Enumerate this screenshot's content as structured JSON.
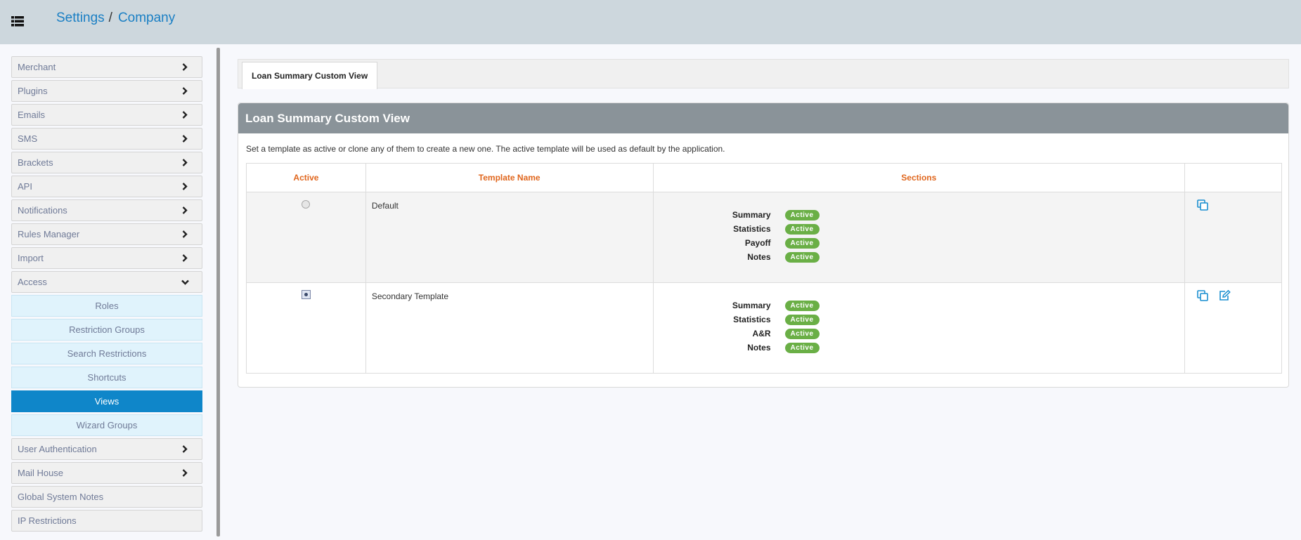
{
  "header": {
    "breadcrumb": [
      "Settings",
      "Company"
    ],
    "breadcrumb_sep": "/"
  },
  "sidebar": {
    "items": [
      {
        "label": "Merchant",
        "chevron": "right"
      },
      {
        "label": "Plugins",
        "chevron": "right"
      },
      {
        "label": "Emails",
        "chevron": "right"
      },
      {
        "label": "SMS",
        "chevron": "right"
      },
      {
        "label": "Brackets",
        "chevron": "right"
      },
      {
        "label": "API",
        "chevron": "right"
      },
      {
        "label": "Notifications",
        "chevron": "right"
      },
      {
        "label": "Rules Manager",
        "chevron": "right"
      },
      {
        "label": "Import",
        "chevron": "right"
      },
      {
        "label": "Access",
        "chevron": "down"
      }
    ],
    "access_subitems": [
      {
        "label": "Roles"
      },
      {
        "label": "Restriction Groups"
      },
      {
        "label": "Search Restrictions"
      },
      {
        "label": "Shortcuts"
      },
      {
        "label": "Views",
        "active": true
      },
      {
        "label": "Wizard Groups"
      }
    ],
    "items_after": [
      {
        "label": "User Authentication",
        "chevron": "right"
      },
      {
        "label": "Mail House",
        "chevron": "right"
      },
      {
        "label": "Global System Notes",
        "chevron": ""
      },
      {
        "label": "IP Restrictions",
        "chevron": ""
      }
    ]
  },
  "tabs": [
    {
      "label": "Loan Summary Custom View"
    }
  ],
  "panel": {
    "title": "Loan Summary Custom View",
    "description": "Set a template as active or clone any of them to create a new one. The active template will be used as default by the application.",
    "columns": [
      "Active",
      "Template Name",
      "Sections",
      ""
    ],
    "rows": [
      {
        "selected": false,
        "name": "Default",
        "sections": [
          {
            "label": "Summary",
            "status": "Active"
          },
          {
            "label": "Statistics",
            "status": "Active"
          },
          {
            "label": "Payoff",
            "status": "Active"
          },
          {
            "label": "Notes",
            "status": "Active"
          }
        ],
        "actions": [
          "copy-icon"
        ]
      },
      {
        "selected": true,
        "name": "Secondary Template",
        "sections": [
          {
            "label": "Summary",
            "status": "Active"
          },
          {
            "label": "Statistics",
            "status": "Active"
          },
          {
            "label": "A&R",
            "status": "Active"
          },
          {
            "label": "Notes",
            "status": "Active"
          }
        ],
        "actions": [
          "copy-icon",
          "edit-icon"
        ]
      }
    ]
  },
  "colors": {
    "topbar": "#cdd7dd",
    "link": "#1a7fc4",
    "active_nav": "#0f86c9",
    "panel_header": "#8a9399",
    "column_header": "#e0661d",
    "badge": "#6aaf46"
  }
}
